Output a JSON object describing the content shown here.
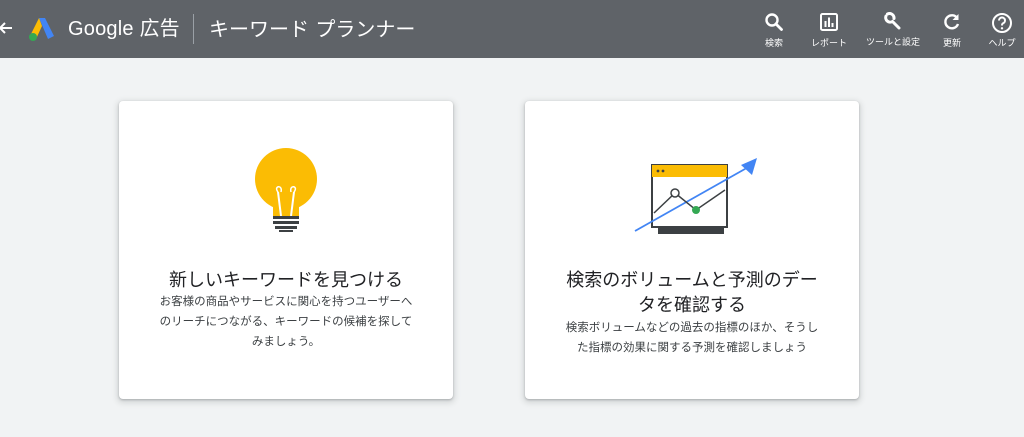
{
  "header": {
    "brand": "Google 広告",
    "tool_title": "キーワード プランナー",
    "actions": [
      {
        "label": "検索",
        "icon": "search-icon"
      },
      {
        "label": "レポート",
        "icon": "reports-icon"
      },
      {
        "label": "ツールと設定",
        "icon": "wrench-icon"
      },
      {
        "label": "更新",
        "icon": "refresh-icon"
      },
      {
        "label": "ヘルプ",
        "icon": "help-icon"
      }
    ]
  },
  "cards": [
    {
      "title": "新しいキーワードを見つける",
      "description_lines": [
        "お客様の商品やサービスに関心を持つユーザーへ",
        "のリーチにつながる、キーワードの候補を探して",
        "みましょう。"
      ],
      "icon": "lightbulb-icon"
    },
    {
      "title_lines": [
        "検索のボリュームと予測のデー",
        "タを確認する"
      ],
      "description_lines": [
        "検索ボリュームなどの過去の指標のほか、そうし",
        "た指標の効果に関する予測を確認しましょう"
      ],
      "icon": "forecast-chart-icon"
    }
  ],
  "colors": {
    "header_bg": "#5f6368",
    "page_bg": "#f1f3f4",
    "accent_yellow": "#fbbc04",
    "accent_blue": "#4285f4",
    "accent_green": "#34a853"
  }
}
